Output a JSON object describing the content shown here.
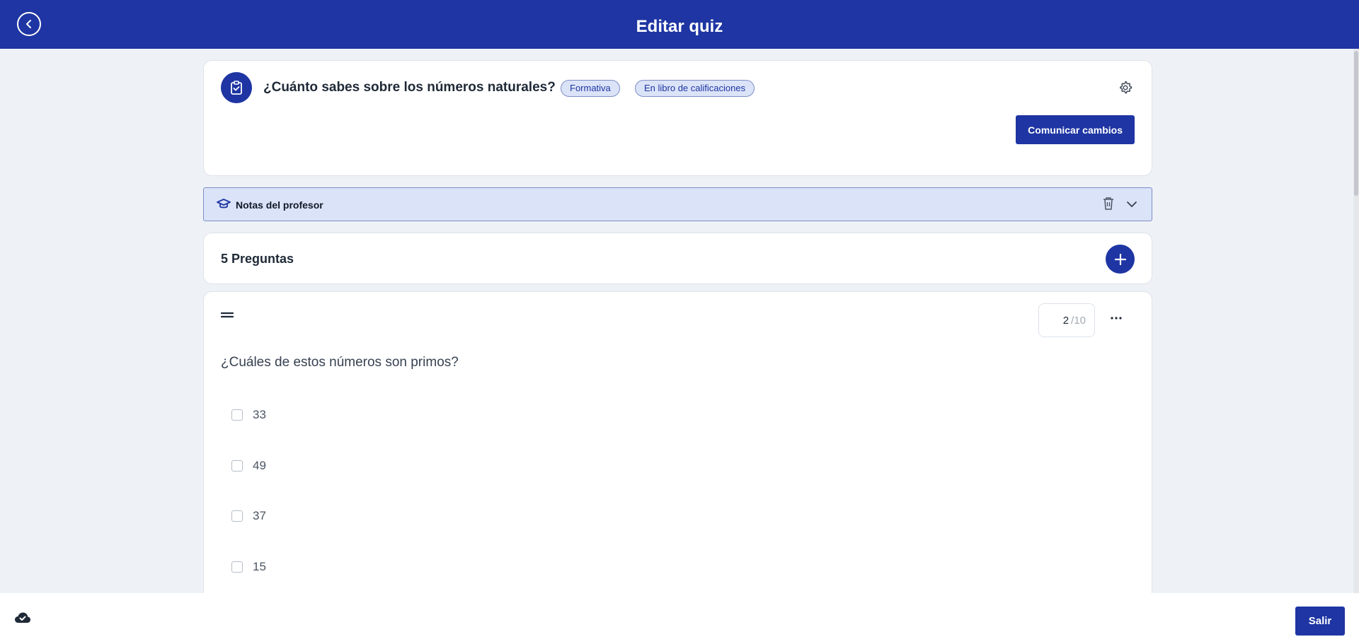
{
  "header": {
    "title": "Editar quiz",
    "back_icon": "chevron-left-icon"
  },
  "quiz": {
    "title": "¿Cuánto sabes sobre los números naturales?",
    "badges": [
      "Formativa",
      "En libro de calificaciones"
    ],
    "communicate_label": "Comunicar cambios",
    "icon": "clipboard-check-icon",
    "settings_icon": "gear-icon"
  },
  "notes": {
    "label": "Notas del profesor",
    "icon": "graduation-cap-icon"
  },
  "questions": {
    "count_label": "5 Preguntas",
    "add_icon": "plus-icon"
  },
  "question": {
    "points": "2",
    "max_points": "/10",
    "text": "¿Cuáles de estos números son primos?",
    "options": [
      "33",
      "49",
      "37",
      "15"
    ]
  },
  "footer": {
    "exit_label": "Salir",
    "save_status_icon": "cloud-check-icon"
  },
  "colors": {
    "primary": "#1e35a3",
    "badge_bg": "#dbe3f8",
    "page_bg": "#eef2f6"
  }
}
